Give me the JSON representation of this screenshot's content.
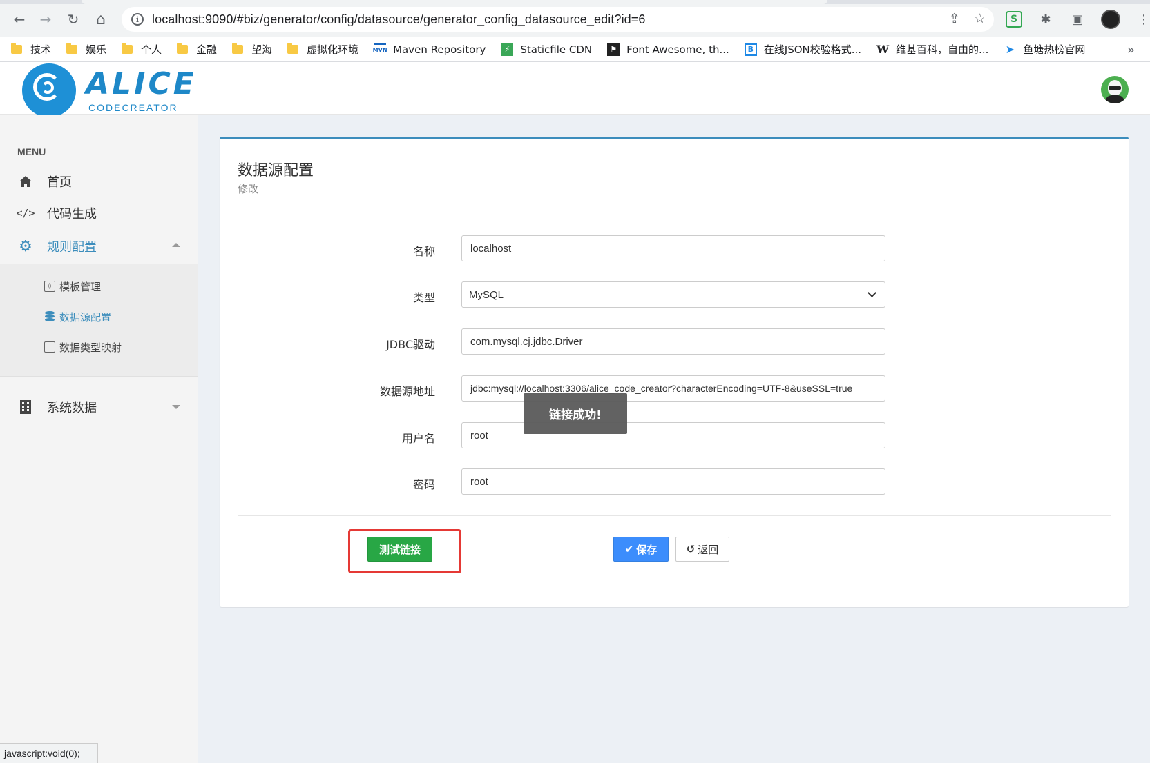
{
  "browser": {
    "url": "localhost:9090/#biz/generator/config/datasource/generator_config_datasource_edit?id=6",
    "nav": {
      "back": "←",
      "forward": "→",
      "reload": "↻",
      "home": "⌂"
    },
    "bookmarks": [
      {
        "label": "技术",
        "icon": "folder-icon"
      },
      {
        "label": "娱乐",
        "icon": "folder-icon"
      },
      {
        "label": "个人",
        "icon": "folder-icon"
      },
      {
        "label": "金融",
        "icon": "folder-icon"
      },
      {
        "label": "望海",
        "icon": "folder-icon"
      },
      {
        "label": "虚拟化环境",
        "icon": "folder-icon"
      },
      {
        "label": "Maven Repository",
        "icon": "mvn-icon"
      },
      {
        "label": "Staticfile CDN",
        "icon": "staticfile-icon"
      },
      {
        "label": "Font Awesome, th...",
        "icon": "flag-icon"
      },
      {
        "label": "在线JSON校验格式...",
        "icon": "b-icon"
      },
      {
        "label": "维基百科，自由的...",
        "icon": "wikipedia-icon"
      },
      {
        "label": "鱼塘热榜官网",
        "icon": "fish-icon"
      }
    ],
    "more": "»",
    "status_text": "javascript:void(0);"
  },
  "header": {
    "logo_text": "ALICE",
    "logo_subtext": "CODECREATOR"
  },
  "sidebar": {
    "menu_label": "MENU",
    "items": [
      {
        "label": "首页",
        "icon": "home-icon"
      },
      {
        "label": "代码生成",
        "icon": "code-icon"
      },
      {
        "label": "规则配置",
        "icon": "gear-icon"
      },
      {
        "label": "系统数据",
        "icon": "building-icon"
      }
    ],
    "subitems": [
      {
        "label": "模板管理",
        "icon": "file-code-icon"
      },
      {
        "label": "数据源配置",
        "icon": "database-icon"
      },
      {
        "label": "数据类型映射",
        "icon": "copy-icon"
      }
    ]
  },
  "card": {
    "title": "数据源配置",
    "subtitle": "修改"
  },
  "form": {
    "name_label": "名称",
    "name_value": "localhost",
    "type_label": "类型",
    "type_value": "MySQL",
    "driver_label": "JDBC驱动",
    "driver_value": "com.mysql.cj.jdbc.Driver",
    "url_label": "数据源地址",
    "url_value": "jdbc:mysql://localhost:3306/alice_code_creator?characterEncoding=UTF-8&useSSL=true",
    "user_label": "用户名",
    "user_value": "root",
    "password_label": "密码",
    "password_value": "root"
  },
  "toast": "链接成功!",
  "buttons": {
    "test": "测试链接",
    "save": "保存",
    "back": "返回"
  }
}
